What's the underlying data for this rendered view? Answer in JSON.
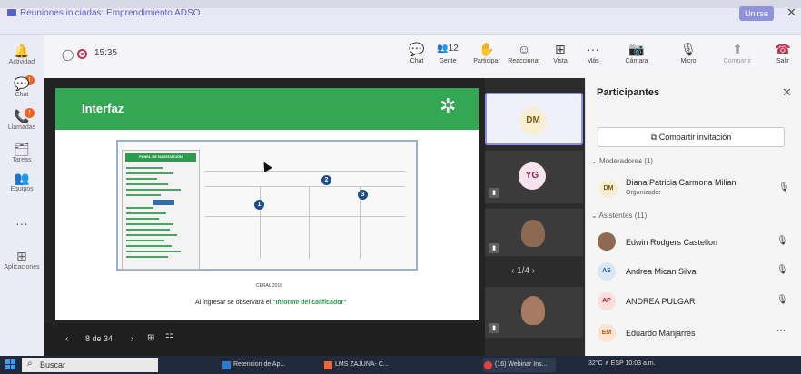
{
  "window": {
    "title": "Reuniones iniciadas: Emprendimiento ADSO",
    "join_label": "Unirse",
    "close_glyph": "✕"
  },
  "rail": {
    "items": [
      {
        "label": "Actividad",
        "icon": "bell-icon",
        "glyph": "🔔",
        "badge": "!"
      },
      {
        "label": "Chat",
        "icon": "chat-icon",
        "glyph": "💬",
        "badge": "!"
      },
      {
        "label": "Llamadas",
        "icon": "phone-icon",
        "glyph": "📞"
      },
      {
        "label": "Tareas",
        "icon": "tasks-icon",
        "glyph": "🗂"
      },
      {
        "label": "Equipos",
        "icon": "teams-icon",
        "glyph": "👥"
      },
      {
        "label": "",
        "icon": "more-icon",
        "glyph": "···"
      },
      {
        "label": "Aplicaciones",
        "icon": "apps-icon",
        "glyph": "⊞"
      }
    ]
  },
  "meeting": {
    "timer": "15:35",
    "toolbar": [
      {
        "label": "Chat",
        "icon": "chat-icon",
        "glyph": "💬"
      },
      {
        "label": "Gente",
        "icon": "people-icon",
        "glyph": "👥12"
      },
      {
        "label": "Participar",
        "icon": "raise-hand-icon",
        "glyph": "✋"
      },
      {
        "label": "Reaccionar",
        "icon": "emoji-icon",
        "glyph": "☺"
      },
      {
        "label": "Vista",
        "icon": "view-icon",
        "glyph": "⊞"
      },
      {
        "label": "Más",
        "icon": "more-icon",
        "glyph": "···"
      },
      {
        "label": "Cámara",
        "icon": "camera-off-icon",
        "glyph": "📷"
      },
      {
        "label": "Micro",
        "icon": "mic-off-icon",
        "glyph": "🎙"
      },
      {
        "label": "Compartir",
        "icon": "share-icon",
        "glyph": "⬆"
      },
      {
        "label": "Salir",
        "icon": "hangup-icon",
        "glyph": "☎"
      }
    ]
  },
  "slide": {
    "title": "Interfaz",
    "nav_title": "PANEL DE NAVEGACIÓN",
    "circles": [
      "1",
      "2",
      "3"
    ],
    "caption": "CERAL 2016",
    "note_prefix": "Al ingresar se observará el ",
    "note_highlight": "\"Informe del calificador\"",
    "counter": "8 de 34"
  },
  "gallery": {
    "tiles": [
      {
        "initials": "DM"
      },
      {
        "initials": "YG"
      },
      {
        "initials": ""
      },
      {
        "initials": ""
      }
    ],
    "pager": "1/4"
  },
  "participants": {
    "title": "Participantes",
    "invite_label": "Compartir invitación",
    "moderators_header": "Moderadores (1)",
    "attendees_header": "Asistentes (11)",
    "moderators": [
      {
        "initials": "DM",
        "name": "Diana Patricia Carmona Milian",
        "role": "Organizador"
      }
    ],
    "attendees": [
      {
        "initials": "",
        "name": "Edwin Rodgers Castellon",
        "photo": true
      },
      {
        "initials": "AS",
        "name": "Andrea Mican Silva",
        "photo": false
      },
      {
        "initials": "AP",
        "name": "ANDREA PULGAR",
        "photo": false
      },
      {
        "initials": "EM",
        "name": "Eduardo Manjarres",
        "photo": false
      }
    ]
  },
  "taskbar": {
    "search_label": "Buscar",
    "apps": [
      "Retencion de Ap...",
      "LMS ZAJUNA- C...",
      "(16) Webinar Ins..."
    ],
    "tray": "32°C  ∧  ESP  10:03 a.m."
  },
  "colors": {
    "accent": "#5b5fc7",
    "slide_green": "#33a754",
    "hangup": "#c4314b"
  }
}
